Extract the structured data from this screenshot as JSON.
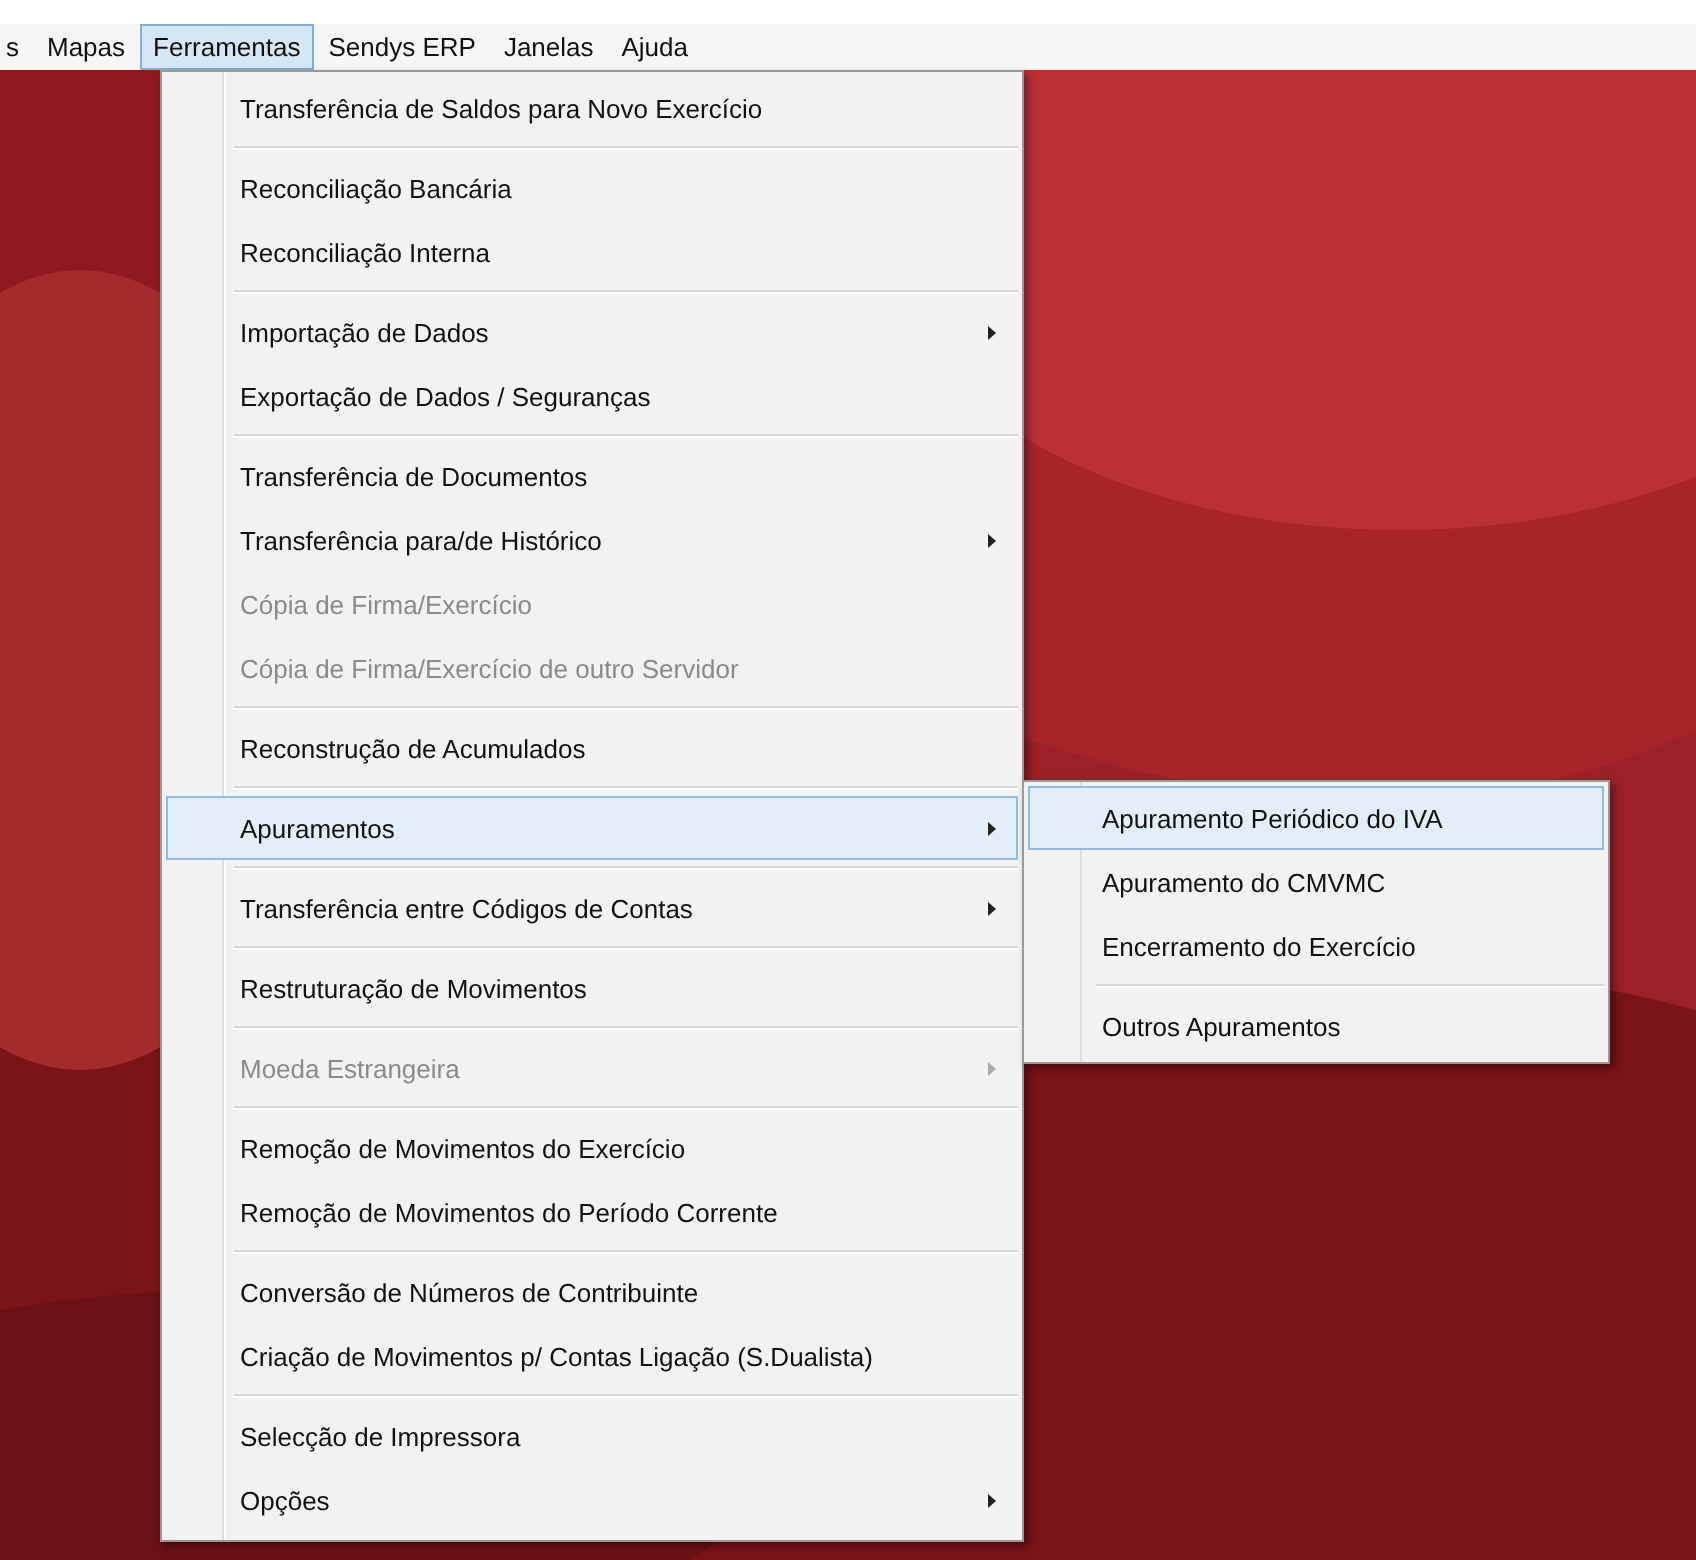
{
  "menubar": [
    {
      "label": "s",
      "selected": false
    },
    {
      "label": "Mapas",
      "selected": false
    },
    {
      "label": "Ferramentas",
      "selected": true
    },
    {
      "label": "Sendys ERP",
      "selected": false
    },
    {
      "label": "Janelas",
      "selected": false
    },
    {
      "label": "Ajuda",
      "selected": false
    }
  ],
  "menu": {
    "groups": [
      [
        {
          "label": "Transferência de Saldos para Novo Exercício",
          "disabled": false,
          "has_submenu": false,
          "selected": false
        }
      ],
      [
        {
          "label": "Reconciliação Bancária",
          "disabled": false,
          "has_submenu": false,
          "selected": false
        },
        {
          "label": "Reconciliação Interna",
          "disabled": false,
          "has_submenu": false,
          "selected": false
        }
      ],
      [
        {
          "label": "Importação de Dados",
          "disabled": false,
          "has_submenu": true,
          "selected": false
        },
        {
          "label": "Exportação de Dados / Seguranças",
          "disabled": false,
          "has_submenu": false,
          "selected": false
        }
      ],
      [
        {
          "label": "Transferência de Documentos",
          "disabled": false,
          "has_submenu": false,
          "selected": false
        },
        {
          "label": "Transferência para/de Histórico",
          "disabled": false,
          "has_submenu": true,
          "selected": false
        },
        {
          "label": "Cópia de Firma/Exercício",
          "disabled": true,
          "has_submenu": false,
          "selected": false
        },
        {
          "label": "Cópia de Firma/Exercício de outro Servidor",
          "disabled": true,
          "has_submenu": false,
          "selected": false
        }
      ],
      [
        {
          "label": "Reconstrução de Acumulados",
          "disabled": false,
          "has_submenu": false,
          "selected": false
        }
      ],
      [
        {
          "label": "Apuramentos",
          "disabled": false,
          "has_submenu": true,
          "selected": true
        }
      ],
      [
        {
          "label": "Transferência entre Códigos de Contas",
          "disabled": false,
          "has_submenu": true,
          "selected": false
        }
      ],
      [
        {
          "label": "Restruturação de Movimentos",
          "disabled": false,
          "has_submenu": false,
          "selected": false
        }
      ],
      [
        {
          "label": "Moeda Estrangeira",
          "disabled": true,
          "has_submenu": true,
          "selected": false
        }
      ],
      [
        {
          "label": "Remoção de Movimentos do Exercício",
          "disabled": false,
          "has_submenu": false,
          "selected": false
        },
        {
          "label": "Remoção de Movimentos do Período Corrente",
          "disabled": false,
          "has_submenu": false,
          "selected": false
        }
      ],
      [
        {
          "label": "Conversão de Números de Contribuinte",
          "disabled": false,
          "has_submenu": false,
          "selected": false
        },
        {
          "label": "Criação de Movimentos p/ Contas Ligação (S.Dualista)",
          "disabled": false,
          "has_submenu": false,
          "selected": false
        }
      ],
      [
        {
          "label": "Selecção de Impressora",
          "disabled": false,
          "has_submenu": false,
          "selected": false
        },
        {
          "label": "Opções",
          "disabled": false,
          "has_submenu": true,
          "selected": false
        }
      ]
    ]
  },
  "submenu": {
    "groups": [
      [
        {
          "label": "Apuramento Periódico do IVA",
          "selected": true
        },
        {
          "label": "Apuramento do CMVMC",
          "selected": false
        },
        {
          "label": "Encerramento do Exercício",
          "selected": false
        }
      ],
      [
        {
          "label": "Outros Apuramentos",
          "selected": false
        }
      ]
    ]
  }
}
